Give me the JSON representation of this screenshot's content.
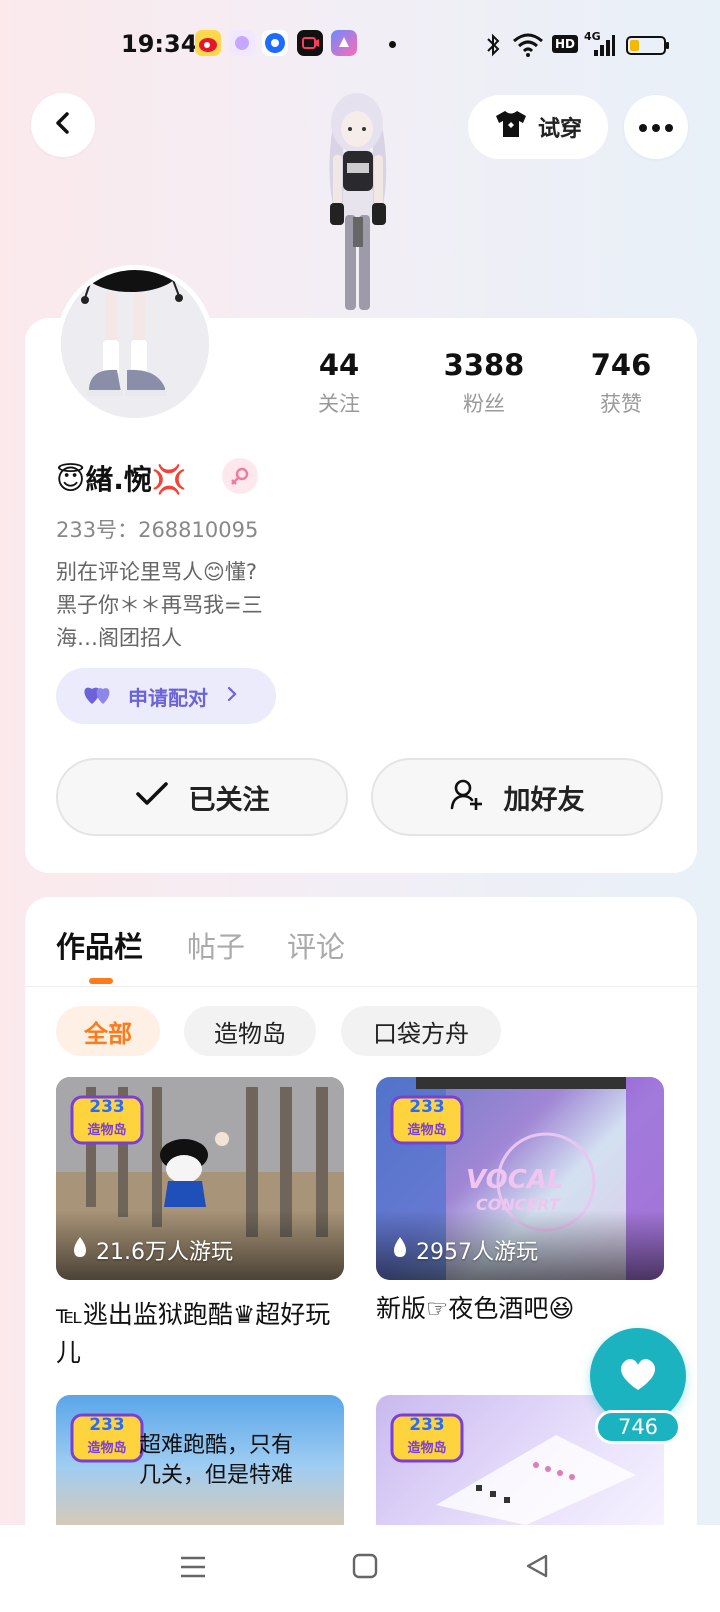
{
  "status_bar": {
    "time": "19:34",
    "icons": [
      "weibo-icon",
      "app-icon",
      "app-icon",
      "camera-app-icon",
      "app-icon",
      "bluetooth-icon",
      "wifi-icon",
      "hd-icon",
      "signal-4g-icon",
      "battery-icon"
    ],
    "hd_label": "HD",
    "network_label": "4G"
  },
  "header": {
    "back_icon": "chevron-left-icon",
    "tryon_label": "试穿",
    "more_icon": "more-icon"
  },
  "profile": {
    "stats": [
      {
        "value": "44",
        "label": "关注"
      },
      {
        "value": "3388",
        "label": "粉丝"
      },
      {
        "value": "746",
        "label": "获赞"
      }
    ],
    "nickname": "😇緖.惋💢",
    "uid_text": "233号：268810095",
    "bio": "别在评论里骂人😊懂?\n黑子你＊＊再骂我=三\n海…阁团招人",
    "pair_button": "申请配对",
    "follow_button": "已关注",
    "add_friend_button": "加好友"
  },
  "tabs": [
    "作品栏",
    "帖子",
    "评论"
  ],
  "filters": [
    "全部",
    "造物岛",
    "口袋方舟"
  ],
  "works": [
    {
      "plays": "21.6万人游玩",
      "title": "℡逃出监狱跑酷♛超好玩儿"
    },
    {
      "plays": "2957人游玩",
      "title": "新版☞夜色酒吧😆"
    },
    {
      "overlay_text": "超难跑酷，只有几关，但是特难"
    },
    {}
  ],
  "badge_text": {
    "top": "233",
    "bottom": "造物岛"
  },
  "vocal_text": {
    "line1": "VOCAL",
    "line2": "CONCERT"
  },
  "like_fab": {
    "count": "746"
  },
  "colors": {
    "accent_orange": "#ff7a1a",
    "teal": "#1bb3c0",
    "purple": "#6c63d8"
  }
}
